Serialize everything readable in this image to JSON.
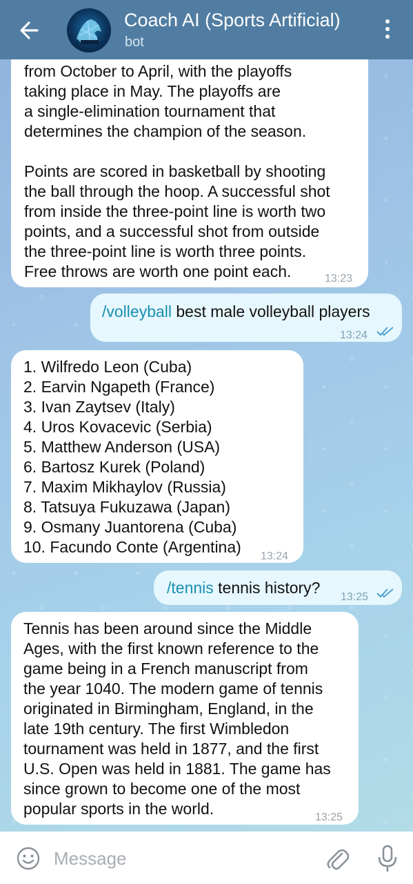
{
  "header": {
    "title": "Coach AI (Sports Artificial)",
    "subtitle": "bot"
  },
  "messages": [
    {
      "side": "in",
      "text": "from October to April, with the playoffs\ntaking place in May. The playoffs are\na single-elimination tournament that\ndetermines the champion of the season.\n\nPoints are scored in basketball by shooting\nthe ball through the hoop. A successful shot\nfrom inside the three-point line is worth two\npoints, and a successful shot from outside\nthe three-point line is worth three points.\nFree throws are worth one point each.",
      "time": "13:23"
    },
    {
      "side": "out",
      "command": "/volleyball",
      "text": " best male volleyball players",
      "time": "13:24",
      "status": "read"
    },
    {
      "side": "in",
      "text": "1. Wilfredo Leon (Cuba)\n2. Earvin Ngapeth (France)\n3. Ivan Zaytsev (Italy)\n4. Uros Kovacevic (Serbia)\n5. Matthew Anderson (USA)\n6. Bartosz Kurek (Poland)\n7. Maxim Mikhaylov (Russia)\n8. Tatsuya Fukuzawa (Japan)\n9. Osmany Juantorena (Cuba)\n10. Facundo Conte (Argentina)",
      "time": "13:24"
    },
    {
      "side": "out",
      "command": "/tennis",
      "text": " tennis history?",
      "time": "13:25",
      "status": "read"
    },
    {
      "side": "in",
      "text": "Tennis has been around since the Middle\nAges, with the first known reference to the\ngame being in a French manuscript from\nthe year 1040. The modern game of tennis\noriginated in Birmingham, England, in the\nlate 19th century. The first Wimbledon\ntournament was held in 1877, and the first\nU.S. Open was held in 1881. The game has\nsince grown to become one of the most\npopular sports in the world.",
      "time": "13:25"
    }
  ],
  "input": {
    "placeholder": "Message"
  },
  "colors": {
    "header": "#517da2",
    "command_link": "#1a8fb2",
    "outgoing_bubble": "#e6f7fd",
    "incoming_bubble": "#ffffff"
  }
}
